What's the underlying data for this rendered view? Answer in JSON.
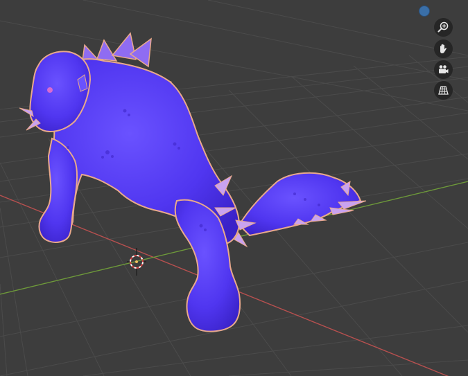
{
  "viewport": {
    "background": "#3d3d3d",
    "grid_color": "#4a4a4a",
    "x_axis_color": "#b8504f",
    "y_axis_color": "#6e9a3a",
    "object_color": "#5a3df5",
    "object_outline_color": "#f0a878",
    "object_spike_color": "#c9a2f0"
  },
  "navigation": {
    "gizmo": {
      "icon": "axis-gizmo-icon",
      "color": "#3a6fa8"
    },
    "buttons": [
      {
        "name": "zoom",
        "icon": "zoom-icon"
      },
      {
        "name": "pan",
        "icon": "hand-icon"
      },
      {
        "name": "camera",
        "icon": "camera-icon"
      },
      {
        "name": "ortho",
        "icon": "grid-perspective-icon"
      }
    ]
  },
  "cursor_3d": {
    "icon": "3d-cursor-icon"
  }
}
